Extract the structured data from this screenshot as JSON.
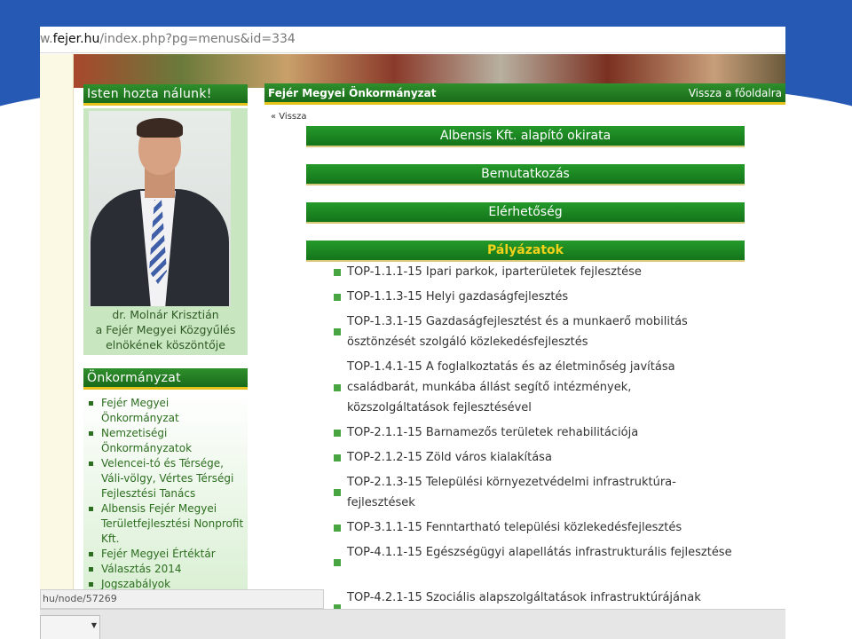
{
  "browser": {
    "url_prefix": "w.",
    "url_host": "fejer.hu",
    "url_path": "/index.php?pg=menus&id=334",
    "status_url": "hu/node/57269"
  },
  "sidebar": {
    "greeting_title": "Isten hozta nálunk!",
    "greeting_lines": [
      "dr. Molnár Krisztián",
      "a Fejér Megyei Közgyűlés",
      "elnökének köszöntője"
    ],
    "section_title": "Önkormányzat",
    "items": [
      {
        "label": "Fejér Megyei Önkormányzat"
      },
      {
        "label": "Nemzetiségi Önkormányzatok"
      },
      {
        "label": "Velencei-tó és Térsége, Váli-völgy, Vértes Térségi Fejlesztési Tanács"
      },
      {
        "label": "Albensis Fejér Megyei Területfejlesztési Nonprofit Kft."
      },
      {
        "label": "Fejér Megyei Értéktár"
      },
      {
        "label": "Választás 2014"
      },
      {
        "label": "Jogszabályok"
      }
    ]
  },
  "main": {
    "title": "Fejér Megyei Önkormányzat",
    "back_home": "Vissza a főoldalra",
    "back": "« Vissza",
    "sections": [
      "Albensis Kft. alapító okirata",
      "Bemutatkozás",
      "Elérhetőség",
      "Pályázatok"
    ],
    "top_items": [
      "TOP-1.1.1-15 Ipari parkok, iparterületek fejlesztése",
      "TOP-1.1.3-15 Helyi gazdaságfejlesztés",
      "TOP-1.3.1-15 Gazdaságfejlesztést és a munkaerő mobilitás ösztönzését szolgáló közlekedésfejlesztés",
      "TOP-1.4.1-15 A foglalkoztatás és az életminőség javítása családbarát, munkába állást segítő intézmények, közszolgáltatások fejlesztésével",
      "TOP-2.1.1-15 Barnamezős területek rehabilitációja",
      "TOP-2.1.2-15 Zöld város kialakítása",
      "TOP-2.1.3-15 Települési környezetvédelmi infrastruktúra-fejlesztések",
      "TOP-3.1.1-15 Fenntartható települési közlekedésfejlesztés",
      "TOP-4.1.1-15 Egészségügyi alapellátás infrastrukturális fejlesztése",
      "TOP-4.2.1-15 Szociális alapszolgáltatások infrastruktúrájának"
    ]
  },
  "colors": {
    "slide_blue": "#2659b3",
    "header_green": "#1a6b1a",
    "accent_yellow": "#e4c21a",
    "bullet_green": "#49a542"
  }
}
